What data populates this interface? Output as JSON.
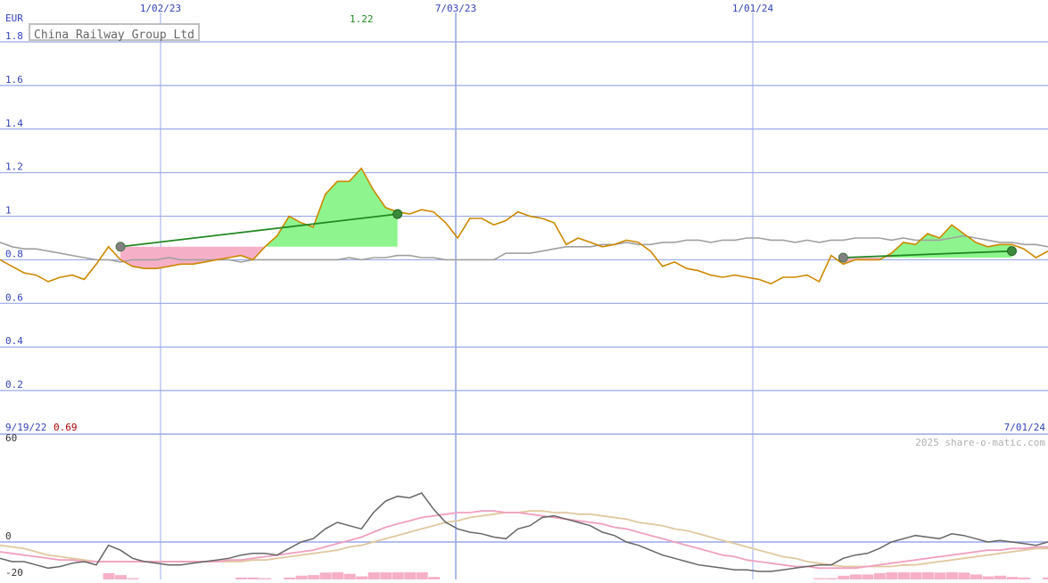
{
  "title": "China Railway Group Ltd",
  "currency": "EUR",
  "peak_label": "1.22",
  "start_date": "9/19/22",
  "start_price": "0.69",
  "end_date": "7/01/24",
  "watermark": "2025 share-o-matic.com",
  "colors": {
    "grid": "#9aa8e8",
    "axis_text": "#3344bb",
    "price": "#cc8800",
    "benchmark": "#a0a0a0",
    "gain_fill": "#8ef58e",
    "loss_fill": "#f5b0c8",
    "trend": "#228822",
    "peak_label": "#228822",
    "start_price_label": "#aa0000",
    "oscillator": "#666666",
    "ma_fast": "#f0a0c0",
    "ma_slow": "#e0c8a0",
    "histogram": "#f5b0c8"
  },
  "chart_data": [
    {
      "type": "line",
      "x": [
        "1/02/23",
        "7/03/23",
        "1/01/24"
      ],
      "y_ticks": [
        "0.2",
        "0.4",
        "0.6",
        "0.8",
        "1",
        "1.2",
        "1.4",
        "1.6",
        "1.8"
      ],
      "ylim": [
        0,
        1.8
      ],
      "ylabel": "EUR",
      "grid": true,
      "series": [
        {
          "values": [
            0.8,
            0.77,
            0.74,
            0.73,
            0.7,
            0.72,
            0.73,
            0.71,
            0.78,
            0.86,
            0.8,
            0.77,
            0.76,
            0.76,
            0.77,
            0.78,
            0.78,
            0.79,
            0.8,
            0.81,
            0.82,
            0.8,
            0.86,
            0.91,
            1.0,
            0.97,
            0.95,
            1.1,
            1.16,
            1.16,
            1.22,
            1.12,
            1.04,
            1.02,
            1.01,
            1.03,
            1.02,
            0.97,
            0.9,
            0.99,
            0.99,
            0.96,
            0.98,
            1.02,
            1.0,
            0.99,
            0.97,
            0.87,
            0.9,
            0.88,
            0.86,
            0.87,
            0.89,
            0.88,
            0.84,
            0.77,
            0.79,
            0.76,
            0.75,
            0.73,
            0.72,
            0.73,
            0.72,
            0.71,
            0.69,
            0.72,
            0.72,
            0.73,
            0.7,
            0.82,
            0.78,
            0.8,
            0.8,
            0.8,
            0.83,
            0.88,
            0.87,
            0.92,
            0.9,
            0.96,
            0.92,
            0.88,
            0.86,
            0.87,
            0.87,
            0.85,
            0.81,
            0.84
          ]
        },
        {
          "values": [
            0.88,
            0.86,
            0.85,
            0.85,
            0.84,
            0.83,
            0.82,
            0.81,
            0.8,
            0.8,
            0.79,
            0.8,
            0.8,
            0.8,
            0.81,
            0.8,
            0.8,
            0.8,
            0.8,
            0.8,
            0.79,
            0.8,
            0.8,
            0.8,
            0.8,
            0.8,
            0.8,
            0.8,
            0.8,
            0.81,
            0.8,
            0.81,
            0.81,
            0.82,
            0.82,
            0.81,
            0.81,
            0.8,
            0.8,
            0.8,
            0.8,
            0.8,
            0.83,
            0.83,
            0.83,
            0.84,
            0.85,
            0.86,
            0.86,
            0.86,
            0.87,
            0.87,
            0.88,
            0.87,
            0.87,
            0.88,
            0.88,
            0.89,
            0.89,
            0.88,
            0.89,
            0.89,
            0.9,
            0.9,
            0.89,
            0.89,
            0.88,
            0.89,
            0.88,
            0.89,
            0.89,
            0.9,
            0.9,
            0.9,
            0.89,
            0.9,
            0.89,
            0.89,
            0.89,
            0.9,
            0.91,
            0.9,
            0.89,
            0.88,
            0.88,
            0.87,
            0.87,
            0.86
          ]
        }
      ],
      "trades": [
        {
          "start": [
            10,
            0.86
          ],
          "end": [
            33,
            1.01
          ],
          "kind": "gain"
        },
        {
          "start": [
            70,
            0.81
          ],
          "end": [
            84,
            0.84
          ],
          "kind": "gain"
        }
      ]
    },
    {
      "type": "line",
      "y_ticks": [
        "-20",
        "0",
        "60"
      ],
      "ylim": [
        -20,
        60
      ],
      "grid": true,
      "series": [
        {
          "values": [
            -10,
            -12,
            -12,
            -14,
            -16,
            -15,
            -13,
            -12,
            -14,
            -2,
            -5,
            -10,
            -12,
            -13,
            -14,
            -14,
            -13,
            -12,
            -11,
            -10,
            -8,
            -7,
            -7,
            -8,
            -4,
            0,
            2,
            8,
            12,
            10,
            8,
            18,
            25,
            28,
            27,
            30,
            20,
            12,
            8,
            6,
            5,
            3,
            2,
            8,
            10,
            15,
            16,
            14,
            12,
            10,
            6,
            4,
            0,
            -2,
            -5,
            -8,
            -10,
            -12,
            -14,
            -15,
            -16,
            -17,
            -17,
            -18,
            -18,
            -17,
            -16,
            -15,
            -14,
            -14,
            -10,
            -8,
            -7,
            -4,
            0,
            2,
            4,
            3,
            2,
            5,
            4,
            2,
            0,
            1,
            0,
            -1,
            -2,
            0
          ]
        },
        {
          "values": [
            -6,
            -7,
            -8,
            -9,
            -10,
            -11,
            -11,
            -12,
            -12,
            -12,
            -12,
            -12,
            -12,
            -12,
            -12,
            -12,
            -12,
            -12,
            -12,
            -11,
            -11,
            -10,
            -9,
            -8,
            -7,
            -6,
            -5,
            -3,
            -1,
            1,
            3,
            6,
            9,
            11,
            13,
            15,
            16,
            17,
            18,
            18,
            19,
            19,
            18,
            18,
            17,
            16,
            15,
            14,
            13,
            12,
            11,
            9,
            8,
            6,
            4,
            2,
            0,
            -2,
            -4,
            -6,
            -8,
            -9,
            -11,
            -12,
            -13,
            -14,
            -15,
            -15,
            -16,
            -16,
            -16,
            -16,
            -15,
            -14,
            -13,
            -12,
            -11,
            -10,
            -9,
            -8,
            -7,
            -6,
            -5,
            -5,
            -4,
            -4,
            -3,
            -3
          ]
        },
        {
          "values": [
            -2,
            -3,
            -4,
            -6,
            -8,
            -9,
            -10,
            -11,
            -12,
            -12,
            -12,
            -12,
            -12,
            -12,
            -12,
            -12,
            -12,
            -12,
            -12,
            -12,
            -12,
            -11,
            -11,
            -10,
            -9,
            -8,
            -7,
            -6,
            -5,
            -3,
            -2,
            0,
            2,
            4,
            6,
            8,
            10,
            12,
            13,
            15,
            16,
            17,
            18,
            18,
            19,
            19,
            18,
            18,
            17,
            17,
            16,
            15,
            14,
            12,
            11,
            10,
            8,
            7,
            5,
            3,
            1,
            -1,
            -3,
            -5,
            -7,
            -9,
            -10,
            -12,
            -13,
            -14,
            -15,
            -15,
            -15,
            -15,
            -15,
            -14,
            -14,
            -13,
            -12,
            -11,
            -10,
            -9,
            -8,
            -7,
            -6,
            -5,
            -4,
            -4
          ]
        }
      ]
    }
  ]
}
